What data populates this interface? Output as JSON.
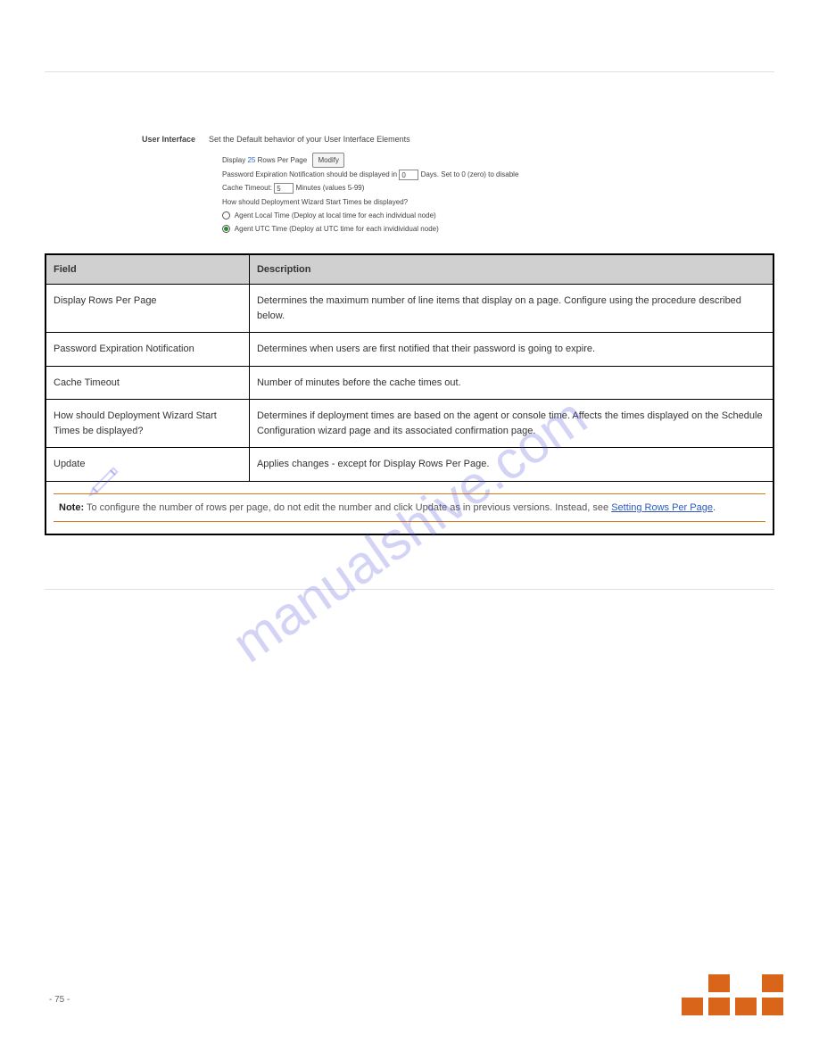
{
  "header": {
    "breadcrumb_left": "",
    "breadcrumb_right": ""
  },
  "title": "",
  "ui": {
    "section_label": "User Interface",
    "section_desc": "Set the Default behavior of your User Interface Elements",
    "rows_prefix": "Display",
    "rows_value": "25",
    "rows_suffix": "Rows Per Page",
    "modify": "Modify",
    "pw_prefix": "Password Expiration Notification should be displayed in",
    "pw_value": "0",
    "pw_suffix": "Days. Set to 0 (zero) to disable",
    "cache_prefix": "Cache Timeout:",
    "cache_value": "5",
    "cache_suffix": "Minutes (values 5-99)",
    "deploy_q": "How should Deployment Wizard Start Times be displayed?",
    "opt_local": "Agent Local Time (Deploy at local time for each individual node)",
    "opt_utc": "Agent UTC Time (Deploy at UTC time for each invidividual node)"
  },
  "caption": "",
  "caption_note": "",
  "fields_heading": "",
  "table": {
    "h1": "Field",
    "h2": "Description",
    "rows": [
      {
        "f": "Display Rows Per Page",
        "d": "Determines the maximum number of line items that display on a page. Configure using the procedure described below."
      },
      {
        "f": "Password Expiration Notification",
        "d": "Determines when users are first notified that their password is going to expire."
      },
      {
        "f": "Cache Timeout",
        "d": "Number of minutes before the cache times out."
      },
      {
        "f": "How should Deployment Wizard Start Times be displayed?",
        "d": "Determines if deployment times are based on the agent or console time. Affects the times displayed on the Schedule Configuration wizard page and its associated confirmation page."
      },
      {
        "f": "Update",
        "d": "Applies changes - except for Display Rows Per Page."
      }
    ]
  },
  "note": {
    "label": "Note:",
    "text": "To configure the number of rows per page, do not edit the number and click Update as in previous versions. Instead, see",
    "link": "Setting Rows Per Page",
    "tail": "."
  },
  "footer_left": "- 75 -",
  "watermark": "manualshive.com"
}
